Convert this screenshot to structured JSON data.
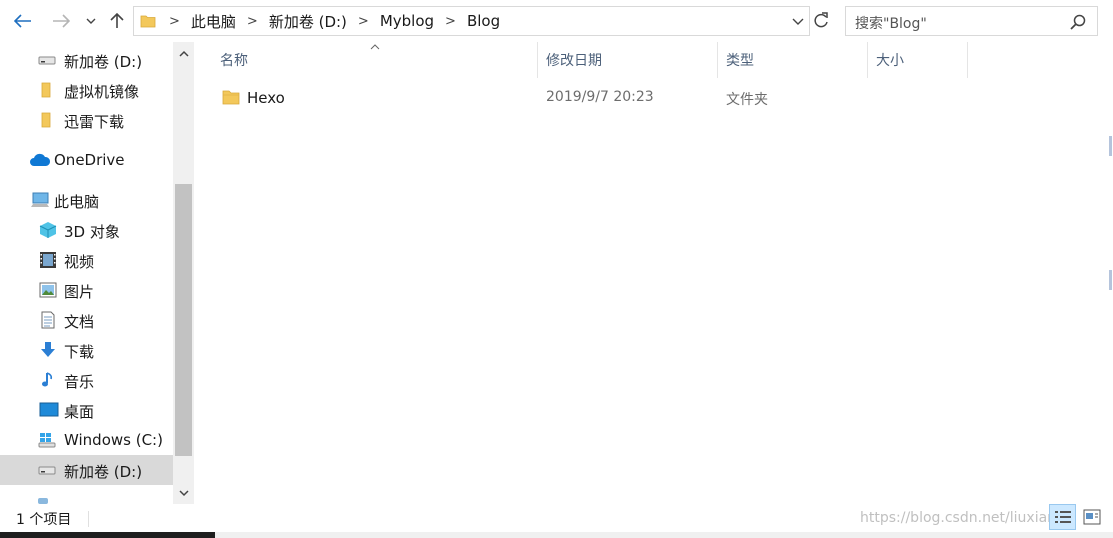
{
  "address_bar": {
    "breadcrumbs": [
      "此电脑",
      "新加卷 (D:)",
      "Myblog",
      "Blog"
    ],
    "separator": ">"
  },
  "search": {
    "placeholder": "搜索\"Blog\""
  },
  "nav_pane": {
    "items": [
      {
        "label": "新加卷 (D:)",
        "icon": "drive-icon"
      },
      {
        "label": "虚拟机镜像",
        "icon": "folder-icon"
      },
      {
        "label": "迅雷下载",
        "icon": "folder-icon"
      },
      {
        "label": "OneDrive",
        "icon": "onedrive-cloud-icon"
      },
      {
        "label": "此电脑",
        "icon": "this-pc-icon"
      },
      {
        "label": "3D 对象",
        "icon": "3d-objects-icon"
      },
      {
        "label": "视频",
        "icon": "videos-icon"
      },
      {
        "label": "图片",
        "icon": "pictures-icon"
      },
      {
        "label": "文档",
        "icon": "documents-icon"
      },
      {
        "label": "下载",
        "icon": "downloads-icon"
      },
      {
        "label": "音乐",
        "icon": "music-icon"
      },
      {
        "label": "桌面",
        "icon": "desktop-icon"
      },
      {
        "label": "Windows (C:)",
        "icon": "windows-drive-icon"
      },
      {
        "label": "新加卷 (D:)",
        "icon": "drive-icon"
      }
    ]
  },
  "file_list": {
    "columns": [
      "名称",
      "修改日期",
      "类型",
      "大小"
    ],
    "rows": [
      {
        "name": "Hexo",
        "modified": "2019/9/7 20:23",
        "type": "文件夹",
        "size": ""
      }
    ]
  },
  "status_bar": {
    "item_count": "1 个项目",
    "watermark": "https://blog.csdn.net/liuxian"
  },
  "colors": {
    "selection": "#cce8ff",
    "folder": "#f3c85b",
    "accent_blue": "#0078d7",
    "header_text": "#4c607a"
  }
}
